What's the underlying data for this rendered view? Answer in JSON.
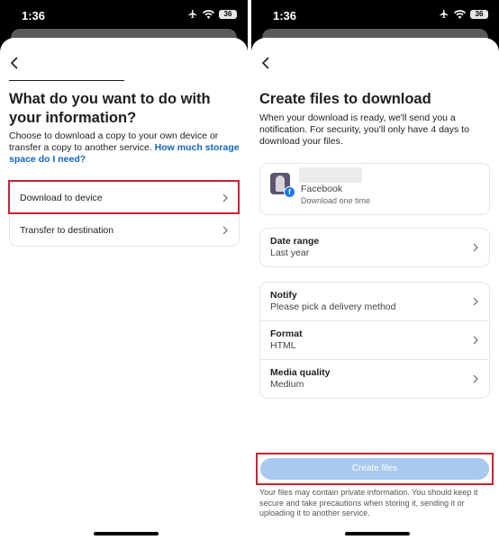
{
  "left_screen": {
    "status": {
      "time": "1:36",
      "battery": "36"
    },
    "title": "What do you want to do with your information?",
    "description": "Choose to download a copy to your own device or transfer a copy to another service.",
    "description_link": "How much storage space do I need?",
    "options": [
      {
        "label": "Download to device"
      },
      {
        "label": "Transfer to destination"
      }
    ]
  },
  "right_screen": {
    "status": {
      "time": "1:36",
      "battery": "36"
    },
    "title": "Create files to download",
    "description": "When your download is ready, we'll send you a notification. For security, you'll only have 4 days to download your files.",
    "account": {
      "platform": "Facebook",
      "subtitle": "Download one time",
      "badge": "f"
    },
    "date_range": {
      "label": "Date range",
      "value": "Last year"
    },
    "settings": [
      {
        "label": "Notify",
        "value": "Please pick a delivery method"
      },
      {
        "label": "Format",
        "value": "HTML"
      },
      {
        "label": "Media quality",
        "value": "Medium"
      }
    ],
    "create_button": "Create files",
    "footer_note": "Your files may contain private information. You should keep it secure and take precautions when storing it, sending it or uploading it to another service."
  },
  "colors": {
    "link": "#1565c0",
    "highlight": "#cc2233",
    "button_disabled": "#a9c9ef",
    "facebook_blue": "#1877f2"
  },
  "icons": [
    "back-arrow-icon",
    "chevron-right-icon",
    "airplane-icon",
    "wifi-icon",
    "battery-icon",
    "facebook-badge-icon"
  ]
}
